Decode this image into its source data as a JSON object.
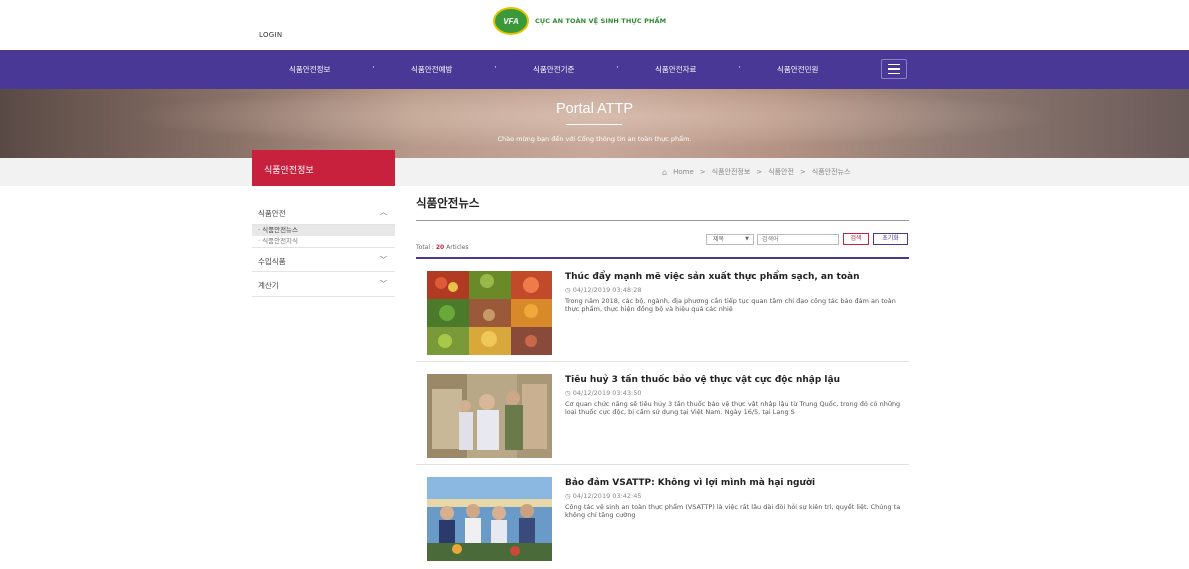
{
  "header": {
    "login": "LOGIN",
    "logo_abbr": "VFA",
    "logo_text": "CỤC AN TOÀN VỆ SINH THỰC PHẨM"
  },
  "nav": {
    "items": [
      "식품안전정보",
      "식품안전예방",
      "식품안전기준",
      "식품안전자료",
      "식품안전민원"
    ],
    "menu_icon": "hamburger-icon"
  },
  "banner": {
    "title": "Portal ATTP",
    "subtitle": "Chào mừng bạn đến với Cổng thông tin an toàn thực phẩm."
  },
  "sidebar": {
    "heading": "식품안전정보",
    "items": [
      {
        "label": "식품안전",
        "expanded": true
      },
      {
        "label": "수입식품"
      },
      {
        "label": "계산기"
      }
    ],
    "sub_items": [
      "식품안전뉴스",
      "식품안전지식"
    ]
  },
  "breadcrumb": {
    "home": "Home",
    "items": [
      "식품안전정보",
      "식품안전",
      "식품안전뉴스"
    ]
  },
  "main": {
    "title": "식품안전뉴스",
    "total_prefix": "Total : ",
    "total_count": "20",
    "total_suffix": " Articles",
    "filter_select": "제목",
    "search_placeholder": "검색어",
    "search_button": "검색",
    "reset_button": "초기화"
  },
  "articles": [
    {
      "title": "Thúc đẩy mạnh mẽ việc sản xuất thực phẩm sạch, an toàn",
      "date": "04/12/2019 03:48:28",
      "desc": "Trong năm 2018, các bộ, ngành, địa phương cần tiếp tục quan tâm chỉ đạo công tác bảo đảm an toàn thực phẩm, thực hiện đồng bộ và hiệu quả các nhiệ"
    },
    {
      "title": "Tiêu huỷ 3 tấn thuốc bảo vệ thực vật cực độc nhập lậu",
      "date": "04/12/2019 03:43:50",
      "desc": "Cơ quan chức năng sẽ tiêu hủy 3 tấn thuốc bảo vệ thực vật nhập lậu từ Trung Quốc, trong đó có những loại thuốc cực độc, bị cấm sử dụng tại Việt Nam. Ngày 16/5, tại Lạng S"
    },
    {
      "title": "Bảo đảm VSATTP: Không vì lợi mình mà hại người",
      "date": "04/12/2019 03:42:45",
      "desc": "Công tác vệ sinh an toàn thực phẩm (VSATTP) là việc rất lâu dài đòi hỏi sự kiên trì, quyết liệt. Chúng ta không chỉ tăng cường"
    }
  ],
  "colors": {
    "nav_bg": "#4a3896",
    "accent_red": "#c8213e",
    "logo_green": "#3a9a3a"
  }
}
